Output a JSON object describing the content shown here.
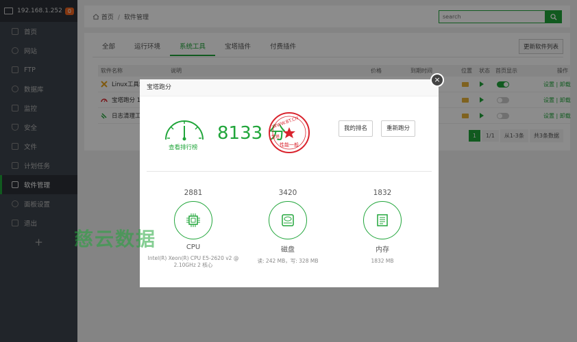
{
  "sidebar": {
    "server_ip": "192.168.1.252",
    "badge": "0",
    "items": [
      {
        "label": "首页"
      },
      {
        "label": "网站"
      },
      {
        "label": "FTP"
      },
      {
        "label": "数据库"
      },
      {
        "label": "监控"
      },
      {
        "label": "安全"
      },
      {
        "label": "文件"
      },
      {
        "label": "计划任务"
      },
      {
        "label": "软件管理"
      },
      {
        "label": "面板设置"
      },
      {
        "label": "退出"
      }
    ],
    "add_label": "+"
  },
  "breadcrumb": {
    "home": "首页",
    "sep": "/",
    "current": "软件管理"
  },
  "search": {
    "placeholder": "search"
  },
  "tabs": [
    {
      "label": "全部"
    },
    {
      "label": "运行环境"
    },
    {
      "label": "系统工具"
    },
    {
      "label": "宝塔插件"
    },
    {
      "label": "付费插件"
    }
  ],
  "update_button": "更新软件列表",
  "table": {
    "headers": {
      "name": "软件名称",
      "desc": "说明",
      "price": "价格",
      "expire": "到期时间",
      "location": "位置",
      "status": "状态",
      "home_display": "首页显示",
      "ops": "操作"
    },
    "rows": [
      {
        "name": "Linux工具箱 1",
        "toggle": true,
        "ops": "设置 | 卸载"
      },
      {
        "name": "宝塔跑分 1.3",
        "toggle": false,
        "ops": "设置 | 卸载"
      },
      {
        "name": "日志清理工具",
        "toggle": false,
        "ops": "设置 | 卸载"
      }
    ]
  },
  "pager": {
    "current": "1",
    "pages": "1/1",
    "range": "从1-3条",
    "total": "共3条数据"
  },
  "modal": {
    "title": "宝塔跑分",
    "close": "×",
    "score": "8133 分",
    "rank_link": "查看排行榜",
    "my_rank_button": "我的排名",
    "rerun_button": "重新跑分",
    "stamp_top": "WWW.BT.CN",
    "stamp_bottom": "性能一般",
    "stamp_side": "宝塔",
    "metrics": [
      {
        "value": "2881",
        "name": "CPU",
        "desc": "Intel(R) Xeon(R) CPU E5-2620 v2 @ 2.10GHz 2 核心"
      },
      {
        "value": "3420",
        "name": "磁盘",
        "desc": "读: 242 MB，写: 328 MB"
      },
      {
        "value": "1832",
        "name": "内存",
        "desc": "1832 MB"
      }
    ]
  },
  "watermark": "慈云数据",
  "colors": {
    "accent": "#20a53a",
    "sidebar": "#3c444d",
    "badge": "#f0651f",
    "stamp": "#d9232d"
  }
}
